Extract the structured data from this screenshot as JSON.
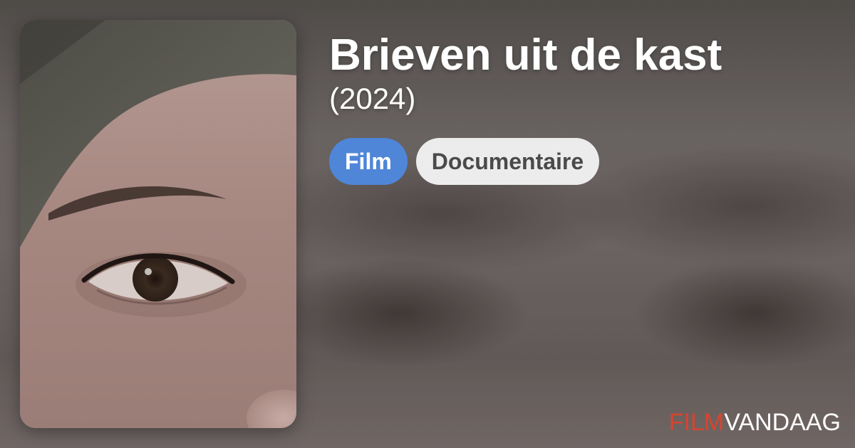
{
  "movie": {
    "title": "Brieven uit de kast",
    "year": "(2024)"
  },
  "tags": [
    {
      "label": "Film",
      "color": "#4f86d8"
    },
    {
      "label": "Documentaire",
      "color": "#ececec"
    }
  ],
  "brand": {
    "part1": "FILM",
    "part2": "VANDAAG",
    "part1_color": "#d9442f",
    "part2_color": "#ffffff"
  }
}
